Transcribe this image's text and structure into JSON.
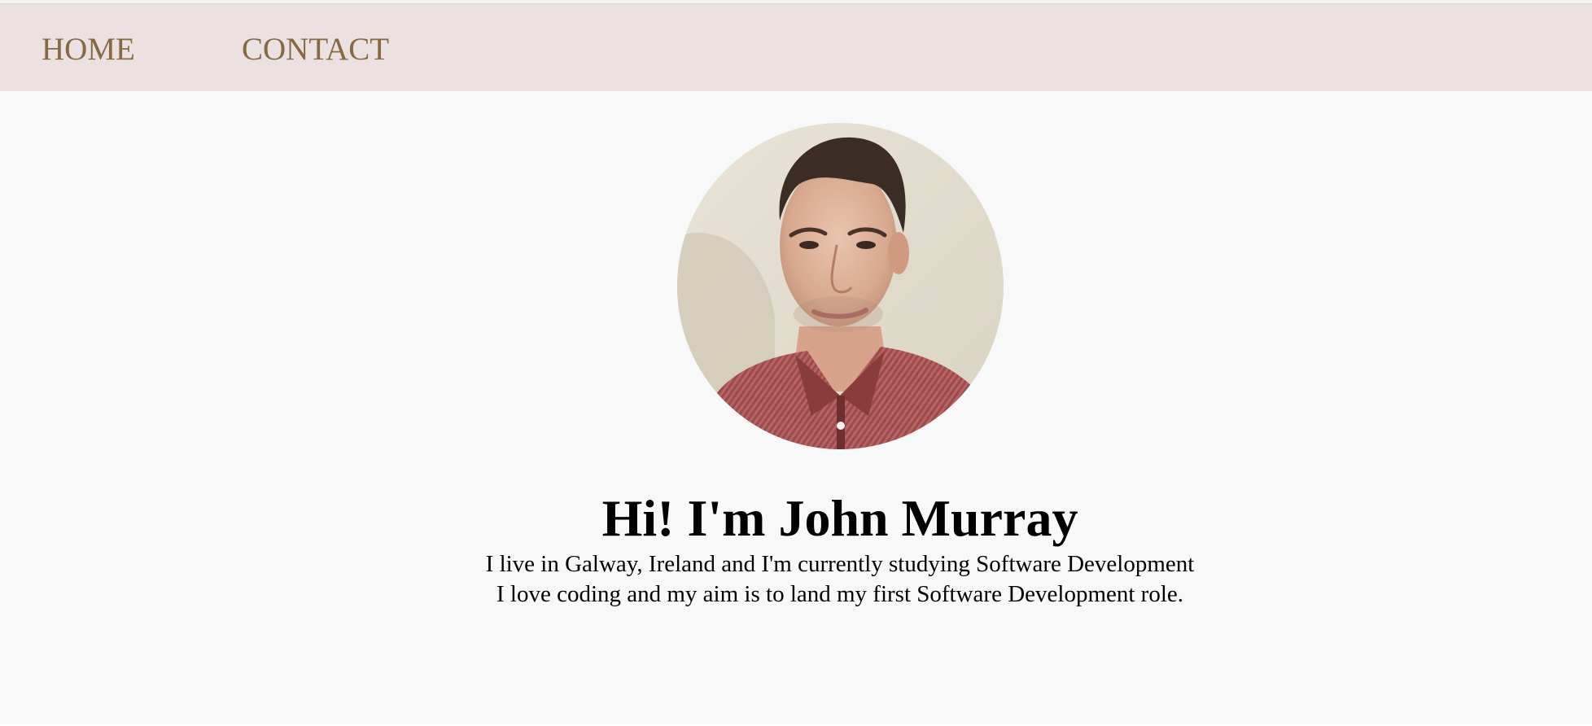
{
  "nav": {
    "items": [
      {
        "label": "HOME"
      },
      {
        "label": "CONTACT"
      }
    ]
  },
  "hero": {
    "avatar_alt": "Profile photo",
    "title": "Hi! I'm John Murray",
    "lines": [
      "I live in Galway, Ireland and I'm currently studying Software Development",
      "I love coding and my aim is to land my first Software Development role."
    ]
  },
  "colors": {
    "nav_background": "#ebe1e0",
    "nav_link": "#836a40",
    "page_background": "#f7f8f7",
    "text": "#000000"
  }
}
